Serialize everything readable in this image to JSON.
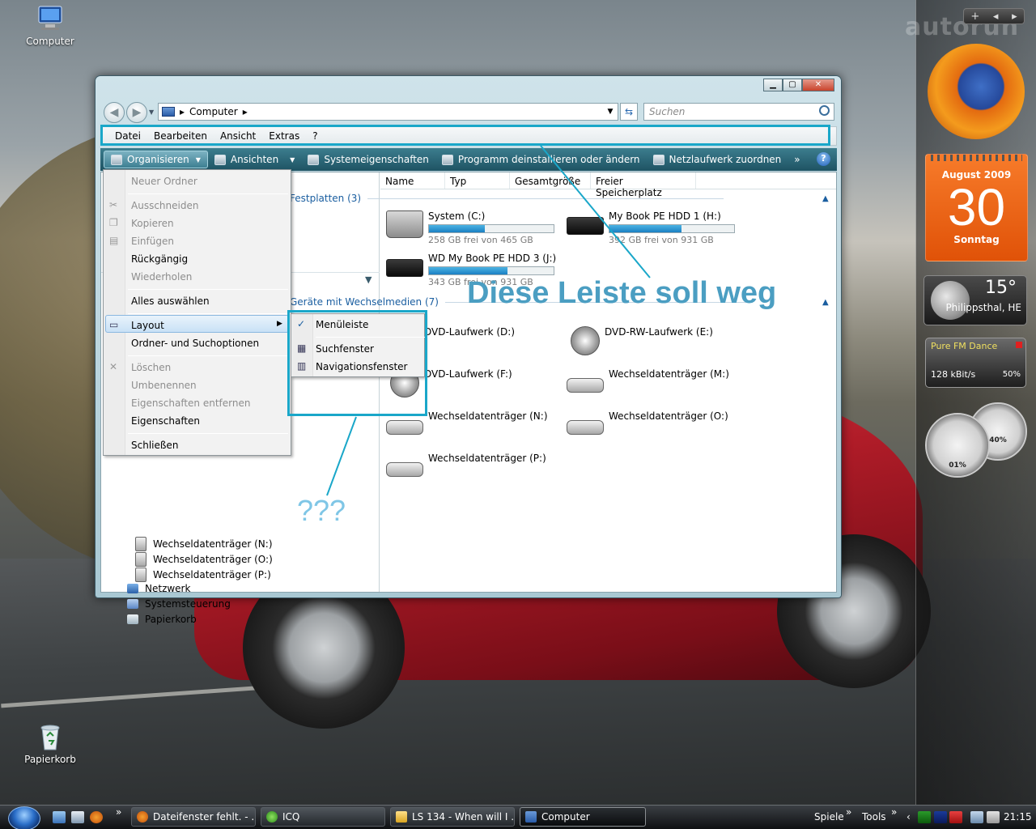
{
  "desktop": {
    "icons": [
      {
        "label": "Computer"
      },
      {
        "label": "Papierkorb"
      }
    ]
  },
  "sidebar": {
    "watermark": "autorun",
    "calendar": {
      "month_year": "August 2009",
      "day": "30",
      "weekday": "Sonntag"
    },
    "weather": {
      "temp": "15°",
      "city": "Philippsthal, HE"
    },
    "radio": {
      "station": "Pure FM Dance",
      "bitrate": "128 kBit/s",
      "volume": "50%"
    },
    "meters": {
      "cpu": "01%",
      "ram": "40%"
    }
  },
  "window": {
    "address": {
      "root": "Computer",
      "sep": "▸"
    },
    "search_placeholder": "Suchen",
    "menubar": [
      "Datei",
      "Bearbeiten",
      "Ansicht",
      "Extras",
      "?"
    ],
    "commands": [
      {
        "label": "Organisieren",
        "dropdown": true
      },
      {
        "label": "Ansichten",
        "dropdown": true
      },
      {
        "label": "Systemeigenschaften"
      },
      {
        "label": "Programm deinstallieren oder ändern"
      },
      {
        "label": "Netzlaufwerk zuordnen"
      }
    ],
    "more": "»",
    "columns": [
      "Name",
      "Typ",
      "Gesamtgröße",
      "Freier Speicherplatz"
    ],
    "groups": {
      "hdd": "Festplatten (3)",
      "removable": "Geräte mit Wechselmedien (7)"
    },
    "hard_drives": [
      {
        "name": "System (C:)",
        "free": "258 GB frei von 465 GB",
        "used_fraction": 0.45
      },
      {
        "name": "My Book PE HDD 1 (H:)",
        "free": "392 GB frei von 931 GB",
        "used_fraction": 0.58
      },
      {
        "name": "WD My Book PE HDD 3 (J:)",
        "free": "343 GB frei von 931 GB",
        "used_fraction": 0.63
      }
    ],
    "removable": [
      {
        "name": "DVD-Laufwerk (D:)"
      },
      {
        "name": "DVD-RW-Laufwerk (E:)"
      },
      {
        "name": "DVD-Laufwerk (F:)"
      },
      {
        "name": "Wechseldatenträger (M:)"
      },
      {
        "name": "Wechseldatenträger (N:)"
      },
      {
        "name": "Wechseldatenträger (O:)"
      },
      {
        "name": "Wechseldatenträger (P:)"
      }
    ],
    "tree": [
      {
        "label": "Wechseldatenträger (N:)"
      },
      {
        "label": "Wechseldatenträger (O:)"
      },
      {
        "label": "Wechseldatenträger (P:)"
      },
      {
        "label": "Netzwerk"
      },
      {
        "label": "Systemsteuerung"
      },
      {
        "label": "Papierkorb"
      }
    ]
  },
  "organize_menu": {
    "items": [
      {
        "label": "Neuer Ordner",
        "disabled": true
      },
      {
        "label": "Ausschneiden",
        "disabled": true
      },
      {
        "label": "Kopieren",
        "disabled": true
      },
      {
        "label": "Einfügen",
        "disabled": true
      },
      {
        "label": "Rückgängig",
        "disabled": false
      },
      {
        "label": "Wiederholen",
        "disabled": true
      },
      {
        "label": "Alles auswählen",
        "disabled": false
      },
      {
        "label": "Layout",
        "disabled": false
      },
      {
        "label": "Ordner- und Suchoptionen",
        "disabled": false
      },
      {
        "label": "Löschen",
        "disabled": true
      },
      {
        "label": "Umbenennen",
        "disabled": true
      },
      {
        "label": "Eigenschaften entfernen",
        "disabled": true
      },
      {
        "label": "Eigenschaften",
        "disabled": false
      },
      {
        "label": "Schließen",
        "disabled": false
      }
    ],
    "layout_submenu": [
      {
        "label": "Menüleiste",
        "checked": true
      },
      {
        "label": "Suchfenster",
        "checked": false
      },
      {
        "label": "Navigationsfenster",
        "checked": false
      }
    ]
  },
  "annotations": {
    "main": "Diese Leiste soll weg",
    "question": "???"
  },
  "taskbar": {
    "buttons": [
      {
        "label": "Dateifenster fehlt. - ..."
      },
      {
        "label": "ICQ"
      },
      {
        "label": "LS 134 - When will I ..."
      },
      {
        "label": "Computer"
      }
    ],
    "toolbars": [
      "Spiele",
      "Tools"
    ],
    "chevron": "»",
    "clock": "21:15"
  },
  "colors": {
    "accent_annotation": "#4b9ec2",
    "highlight_box": "#1aa7c9",
    "command_bar": "#2a6676",
    "progress": "#1b7fc2"
  }
}
